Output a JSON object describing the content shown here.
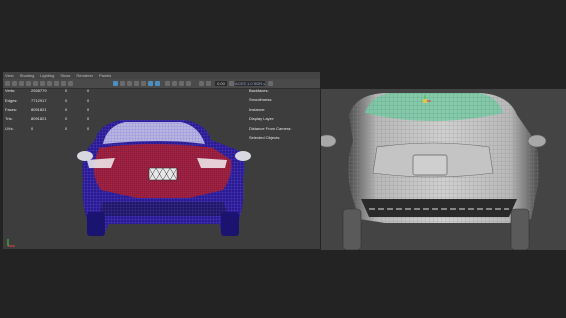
{
  "menu": [
    "View",
    "Shading",
    "Lighting",
    "Show",
    "Renderer",
    "Panels"
  ],
  "toolbar": {
    "field_a": "0.00",
    "field_b": "ACES 1.0 SDR-video",
    "active_icons": [
      10,
      15,
      16
    ]
  },
  "stats": [
    {
      "label": "Verts:",
      "v1": "2928779",
      "v2": "0",
      "v3": "0"
    },
    {
      "label": "Edges:",
      "v1": "7712917",
      "v2": "0",
      "v3": "0"
    },
    {
      "label": "Faces:",
      "v1": "8091821",
      "v2": "0",
      "v3": "0"
    },
    {
      "label": "Tris:",
      "v1": "8091821",
      "v2": "0",
      "v3": "0"
    },
    {
      "label": "UVs:",
      "v1": "0",
      "v2": "0",
      "v3": "0"
    }
  ],
  "hud_right": [
    "Backfaces:",
    "Smoothness:",
    "Instance:",
    "Display Layer:",
    "Distance From Camera:",
    "Selected Objects:"
  ],
  "icons": {
    "axis": "axis-gizmo-icon",
    "view_cube": "view-cube-icon"
  },
  "colors": {
    "wireframe": "#3a22a8",
    "wireframe_highlight": "#b0203a",
    "glass": "#7ac9a4",
    "viewport_bg": "#3d3d3d",
    "frame_bg": "#232323"
  }
}
